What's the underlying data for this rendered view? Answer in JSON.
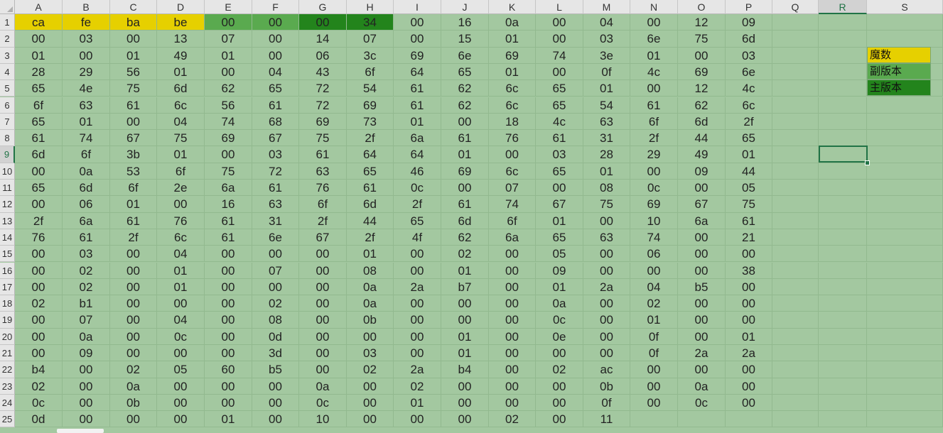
{
  "columns": [
    "A",
    "B",
    "C",
    "D",
    "E",
    "F",
    "G",
    "H",
    "I",
    "J",
    "K",
    "L",
    "M",
    "N",
    "O",
    "P",
    "Q",
    "R",
    "S"
  ],
  "selected_column": "R",
  "selected_row": "9",
  "active_cell": "R9",
  "rows": [
    {
      "n": "1",
      "cells": [
        "ca",
        "fe",
        "ba",
        "be",
        "00",
        "00",
        "00",
        "34",
        "00",
        "16",
        "0a",
        "00",
        "04",
        "00",
        "12",
        "09"
      ]
    },
    {
      "n": "2",
      "cells": [
        "00",
        "03",
        "00",
        "13",
        "07",
        "00",
        "14",
        "07",
        "00",
        "15",
        "01",
        "00",
        "03",
        "6e",
        "75",
        "6d"
      ]
    },
    {
      "n": "3",
      "cells": [
        "01",
        "00",
        "01",
        "49",
        "01",
        "00",
        "06",
        "3c",
        "69",
        "6e",
        "69",
        "74",
        "3e",
        "01",
        "00",
        "03"
      ]
    },
    {
      "n": "4",
      "cells": [
        "28",
        "29",
        "56",
        "01",
        "00",
        "04",
        "43",
        "6f",
        "64",
        "65",
        "01",
        "00",
        "0f",
        "4c",
        "69",
        "6e"
      ]
    },
    {
      "n": "5",
      "cells": [
        "65",
        "4e",
        "75",
        "6d",
        "62",
        "65",
        "72",
        "54",
        "61",
        "62",
        "6c",
        "65",
        "01",
        "00",
        "12",
        "4c"
      ]
    },
    {
      "n": "6",
      "cells": [
        "6f",
        "63",
        "61",
        "6c",
        "56",
        "61",
        "72",
        "69",
        "61",
        "62",
        "6c",
        "65",
        "54",
        "61",
        "62",
        "6c"
      ]
    },
    {
      "n": "7",
      "cells": [
        "65",
        "01",
        "00",
        "04",
        "74",
        "68",
        "69",
        "73",
        "01",
        "00",
        "18",
        "4c",
        "63",
        "6f",
        "6d",
        "2f"
      ]
    },
    {
      "n": "8",
      "cells": [
        "61",
        "74",
        "67",
        "75",
        "69",
        "67",
        "75",
        "2f",
        "6a",
        "61",
        "76",
        "61",
        "31",
        "2f",
        "44",
        "65"
      ]
    },
    {
      "n": "9",
      "cells": [
        "6d",
        "6f",
        "3b",
        "01",
        "00",
        "03",
        "61",
        "64",
        "64",
        "01",
        "00",
        "03",
        "28",
        "29",
        "49",
        "01"
      ]
    },
    {
      "n": "10",
      "cells": [
        "00",
        "0a",
        "53",
        "6f",
        "75",
        "72",
        "63",
        "65",
        "46",
        "69",
        "6c",
        "65",
        "01",
        "00",
        "09",
        "44"
      ]
    },
    {
      "n": "11",
      "cells": [
        "65",
        "6d",
        "6f",
        "2e",
        "6a",
        "61",
        "76",
        "61",
        "0c",
        "00",
        "07",
        "00",
        "08",
        "0c",
        "00",
        "05"
      ]
    },
    {
      "n": "12",
      "cells": [
        "00",
        "06",
        "01",
        "00",
        "16",
        "63",
        "6f",
        "6d",
        "2f",
        "61",
        "74",
        "67",
        "75",
        "69",
        "67",
        "75"
      ]
    },
    {
      "n": "13",
      "cells": [
        "2f",
        "6a",
        "61",
        "76",
        "61",
        "31",
        "2f",
        "44",
        "65",
        "6d",
        "6f",
        "01",
        "00",
        "10",
        "6a",
        "61"
      ]
    },
    {
      "n": "14",
      "cells": [
        "76",
        "61",
        "2f",
        "6c",
        "61",
        "6e",
        "67",
        "2f",
        "4f",
        "62",
        "6a",
        "65",
        "63",
        "74",
        "00",
        "21"
      ]
    },
    {
      "n": "15",
      "cells": [
        "00",
        "03",
        "00",
        "04",
        "00",
        "00",
        "00",
        "01",
        "00",
        "02",
        "00",
        "05",
        "00",
        "06",
        "00",
        "00"
      ]
    },
    {
      "n": "16",
      "cells": [
        "00",
        "02",
        "00",
        "01",
        "00",
        "07",
        "00",
        "08",
        "00",
        "01",
        "00",
        "09",
        "00",
        "00",
        "00",
        "38"
      ]
    },
    {
      "n": "17",
      "cells": [
        "00",
        "02",
        "00",
        "01",
        "00",
        "00",
        "00",
        "0a",
        "2a",
        "b7",
        "00",
        "01",
        "2a",
        "04",
        "b5",
        "00"
      ]
    },
    {
      "n": "18",
      "cells": [
        "02",
        "b1",
        "00",
        "00",
        "00",
        "02",
        "00",
        "0a",
        "00",
        "00",
        "00",
        "0a",
        "00",
        "02",
        "00",
        "00"
      ]
    },
    {
      "n": "19",
      "cells": [
        "00",
        "07",
        "00",
        "04",
        "00",
        "08",
        "00",
        "0b",
        "00",
        "00",
        "00",
        "0c",
        "00",
        "01",
        "00",
        "00"
      ]
    },
    {
      "n": "20",
      "cells": [
        "00",
        "0a",
        "00",
        "0c",
        "00",
        "0d",
        "00",
        "00",
        "00",
        "01",
        "00",
        "0e",
        "00",
        "0f",
        "00",
        "01"
      ]
    },
    {
      "n": "21",
      "cells": [
        "00",
        "09",
        "00",
        "00",
        "00",
        "3d",
        "00",
        "03",
        "00",
        "01",
        "00",
        "00",
        "00",
        "0f",
        "2a",
        "2a"
      ]
    },
    {
      "n": "22",
      "cells": [
        "b4",
        "00",
        "02",
        "05",
        "60",
        "b5",
        "00",
        "02",
        "2a",
        "b4",
        "00",
        "02",
        "ac",
        "00",
        "00",
        "00"
      ]
    },
    {
      "n": "23",
      "cells": [
        "02",
        "00",
        "0a",
        "00",
        "00",
        "00",
        "0a",
        "00",
        "02",
        "00",
        "00",
        "00",
        "0b",
        "00",
        "0a",
        "00"
      ]
    },
    {
      "n": "24",
      "cells": [
        "0c",
        "00",
        "0b",
        "00",
        "00",
        "00",
        "0c",
        "00",
        "01",
        "00",
        "00",
        "00",
        "0f",
        "00",
        "0c",
        "00"
      ]
    },
    {
      "n": "25",
      "cells": [
        "0d",
        "00",
        "00",
        "00",
        "01",
        "00",
        "10",
        "00",
        "00",
        "00",
        "02",
        "00",
        "11",
        "",
        "",
        ""
      ]
    }
  ],
  "row1_highlights": {
    "magic": [
      0,
      1,
      2,
      3
    ],
    "minor": [
      4,
      5
    ],
    "major": [
      6,
      7
    ]
  },
  "legend": [
    {
      "label": "魔数",
      "kind": "magic"
    },
    {
      "label": "副版本",
      "kind": "minor"
    },
    {
      "label": "主版本",
      "kind": "major"
    }
  ],
  "colors": {
    "background": "#a3c8a0",
    "magic": "#e6d000",
    "minor": "#5aaa4f",
    "major": "#23841c",
    "accent": "#217346"
  }
}
